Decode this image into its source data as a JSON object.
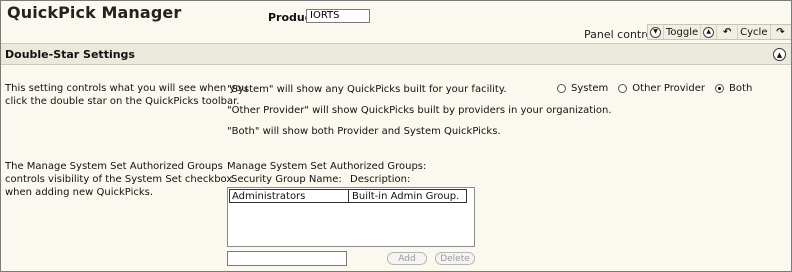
{
  "header": {
    "app_title": "QuickPick Manager",
    "product_label": "Product",
    "product_value": "IORTS"
  },
  "panel_control": {
    "label": "Panel control",
    "toggle_label": "Toggle",
    "cycle_label": "Cycle",
    "icons": [
      "chevron-down-circle-icon",
      "chevron-up-circle-icon",
      "undo-icon",
      "redo-icon"
    ]
  },
  "section": {
    "title": "Double-Star Settings",
    "collapse_icon": "chevron-up-circle-icon"
  },
  "double_star": {
    "description_line1": "This setting controls what you will see when you",
    "description_line2": "click the double star on the  QuickPicks toolbar.",
    "info_system": "\"System\" will show any QuickPicks built for your facility.",
    "info_other": "\"Other Provider\" will show QuickPicks built by providers in your organization.",
    "info_both": "\"Both\" will show both Provider and System QuickPicks.",
    "options": [
      {
        "label": "System",
        "checked": false
      },
      {
        "label": "Other Provider",
        "checked": false
      },
      {
        "label": "Both",
        "checked": true
      }
    ]
  },
  "auth_groups": {
    "description_line1": "The Manage System Set Authorized Groups",
    "description_line2": "controls visibility of the System Set checkbox",
    "description_line3": "when adding new QuickPicks.",
    "heading": "Manage System Set Authorized Groups:",
    "col_name": "Security Group Name:",
    "col_desc": "Description:",
    "rows": [
      {
        "name": "Administrators",
        "description": "Built-in Admin Group."
      }
    ],
    "new_group_value": "",
    "add_label": "Add",
    "delete_label": "Delete"
  }
}
